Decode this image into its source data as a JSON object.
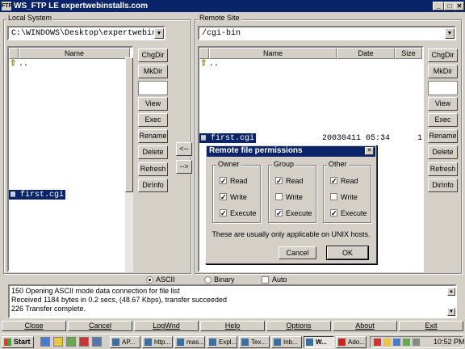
{
  "window": {
    "title": "WS_FTP LE expertwebinstalls.com",
    "icon": "ftp-icon",
    "controls": [
      "_",
      "□",
      "✕"
    ]
  },
  "local": {
    "group_label": "Local System",
    "path": "C:\\WINDOWS\\Desktop\\expertwebins",
    "column_name": "Name",
    "parent_entry": "..",
    "file_selected": "first.cgi",
    "buttons": [
      "ChgDir",
      "MkDir",
      "",
      "View",
      "Exec",
      "Rename",
      "Delete",
      "Refresh",
      "DirInfo"
    ]
  },
  "remote": {
    "group_label": "Remote Site",
    "path": "/cgi-bin",
    "columns": {
      "name": "Name",
      "date": "Date",
      "size": "Size"
    },
    "parent_entry": "..",
    "file": {
      "name": "first.cgi",
      "date": "20030411 05:34",
      "size": "1"
    },
    "buttons": [
      "ChgDir",
      "MkDir",
      "",
      "View",
      "Exec",
      "Rename",
      "Delete",
      "Refresh",
      "DirInfo"
    ]
  },
  "transfer": {
    "left": "<--",
    "right": "-->"
  },
  "mode": {
    "ascii": "ASCII",
    "binary": "Binary",
    "auto": "Auto",
    "selected": "ascii"
  },
  "dialog": {
    "title": "Remote file permissions",
    "groups": [
      {
        "label": "Owner",
        "items": [
          {
            "label": "Read",
            "checked": true
          },
          {
            "label": "Write",
            "checked": true
          },
          {
            "label": "Execute",
            "checked": true
          }
        ]
      },
      {
        "label": "Group",
        "items": [
          {
            "label": "Read",
            "checked": true
          },
          {
            "label": "Write",
            "checked": false
          },
          {
            "label": "Execute",
            "checked": true
          }
        ]
      },
      {
        "label": "Other",
        "items": [
          {
            "label": "Read",
            "checked": true
          },
          {
            "label": "Write",
            "checked": false
          },
          {
            "label": "Execute",
            "checked": true
          }
        ]
      }
    ],
    "note": "These are usually only applicable on UNIX hosts.",
    "cancel": "Cancel",
    "ok": "OK"
  },
  "log": [
    "150 Opening ASCII mode data connection for file list",
    "Received 1184 bytes in 0.2 secs, (48.67 Kbps), transfer succeeded",
    "226 Transfer complete."
  ],
  "bottom_buttons": [
    "Close",
    "Cancel",
    "LogWnd",
    "Help",
    "Options",
    "About",
    "Exit"
  ],
  "taskbar": {
    "start": "Start",
    "tasks": [
      "AP...",
      "http...",
      "mas...",
      "Expl...",
      "Tex...",
      "Inb...",
      "W...",
      "Ado..."
    ],
    "clock": "10:52 PM"
  },
  "colors": {
    "titlebar": "#0a246a",
    "face": "#d4d0c8",
    "selection": "#0a246a"
  }
}
